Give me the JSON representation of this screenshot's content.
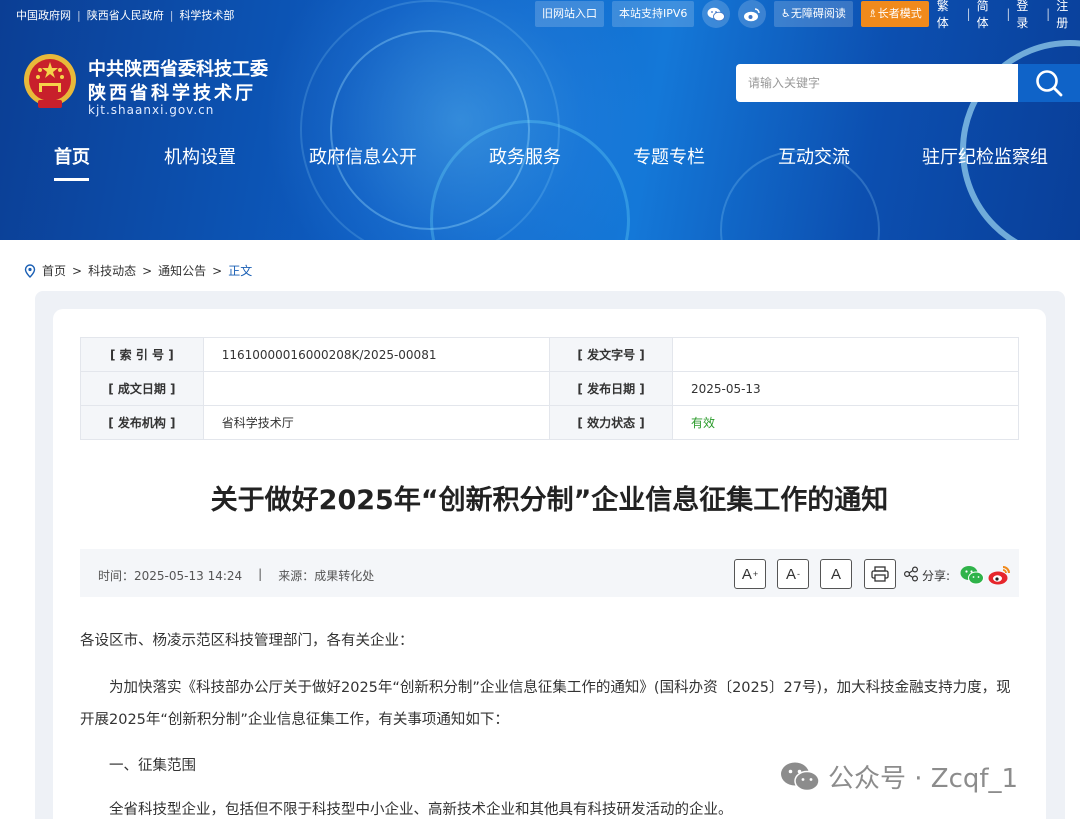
{
  "topbar": {
    "links": [
      "中国政府网",
      "陕西省人民政府",
      "科学技术部"
    ],
    "old_site": "旧网站入口",
    "ipv6": "本站支持IPV6",
    "accessibility": "无障碍阅读",
    "elder_mode": "长者模式",
    "traditional": "繁体",
    "simplified": "简体",
    "login": "登录",
    "register": "注册"
  },
  "site": {
    "title_line1": "中共陕西省委科技工委",
    "title_line2": "陕西省科学技术厅",
    "domain": "kjt.shaanxi.gov.cn"
  },
  "search": {
    "placeholder": "请输入关键字"
  },
  "nav": {
    "items": [
      "首页",
      "机构设置",
      "政府信息公开",
      "政务服务",
      "专题专栏",
      "互动交流",
      "驻厅纪检监察组"
    ],
    "active": "首页"
  },
  "breadcrumb": {
    "home": "首页",
    "level1": "科技动态",
    "level2": "通知公告",
    "current": "正文",
    "sep": ">"
  },
  "meta": {
    "index_label": "[ 索 引 号 ]",
    "index_value": "11610000016000208K/2025-00081",
    "doc_no_label": "[ 发文字号 ]",
    "doc_no_value": "",
    "written_label": "[ 成文日期 ]",
    "written_value": "",
    "publish_label": "[ 发布日期 ]",
    "publish_value": "2025-05-13",
    "org_label": "[ 发布机构 ]",
    "org_value": "省科学技术厅",
    "status_label": "[ 效力状态 ]",
    "status_value": "有效"
  },
  "article": {
    "title": "关于做好2025年“创新积分制”企业信息征集工作的通知",
    "time_label": "时间：",
    "time_value": "2025-05-13 14:24",
    "divider": "|",
    "source_label": "来源：",
    "source_value": "成果转化处",
    "font_large": "A",
    "font_small": "A",
    "font_default": "A",
    "share_label": "分享:",
    "salutation": "各设区市、杨凌示范区科技管理部门，各有关企业：",
    "para1_line1": "为加快落实《科技部办公厅关于做好2025年“创新积分制”企业信息征集工作的通知》(国科办资〔2025〕27号)，加大科技金融支持力度，现",
    "para1_line2": "开展2025年“创新积分制”企业信息征集工作，有关事项通知如下：",
    "section1": "一、征集范围",
    "section1_text": "全省科技型企业，包括但不限于科技型中小企业、高新技术企业和其他具有科技研发活动的企业。"
  },
  "watermark": {
    "text": "公众号 · Zcqf_1"
  }
}
